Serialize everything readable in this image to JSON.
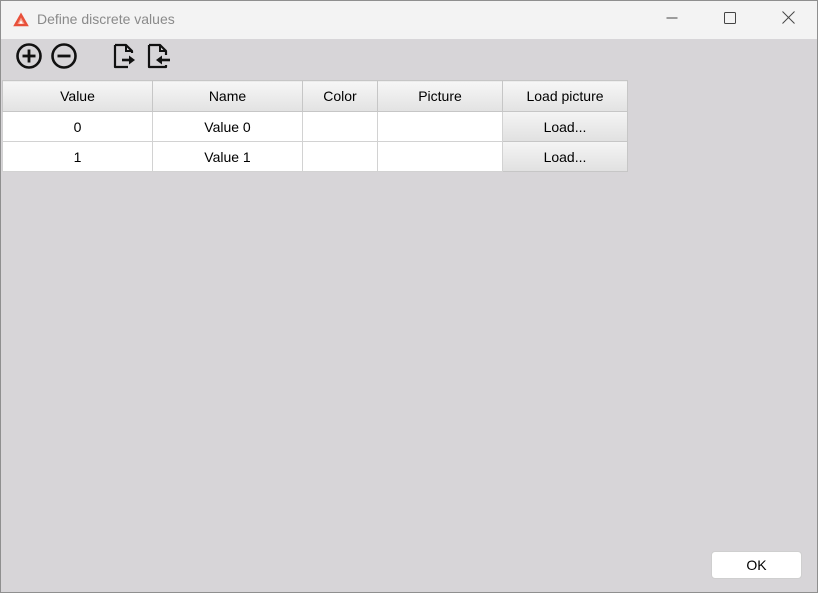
{
  "window": {
    "title": "Define discrete values",
    "app_icon": "triangle-app-icon",
    "controls": [
      "minimize-icon",
      "maximize-icon",
      "close-icon"
    ]
  },
  "toolbar": {
    "buttons": [
      "add-circle-icon",
      "remove-circle-icon",
      "import-file-icon",
      "export-file-icon"
    ]
  },
  "table": {
    "headers": {
      "value": "Value",
      "name": "Name",
      "color": "Color",
      "picture": "Picture",
      "load_picture": "Load picture"
    },
    "rows": [
      {
        "value": "0",
        "name": "Value 0",
        "color": "",
        "picture": "",
        "load": "Load..."
      },
      {
        "value": "1",
        "name": "Value 1",
        "color": "",
        "picture": "",
        "load": "Load..."
      }
    ]
  },
  "footer": {
    "ok_label": "OK"
  },
  "colors": {
    "accent": "#e8503a",
    "background": "#d7d5d8",
    "titlebar": "#f3f3f3"
  }
}
